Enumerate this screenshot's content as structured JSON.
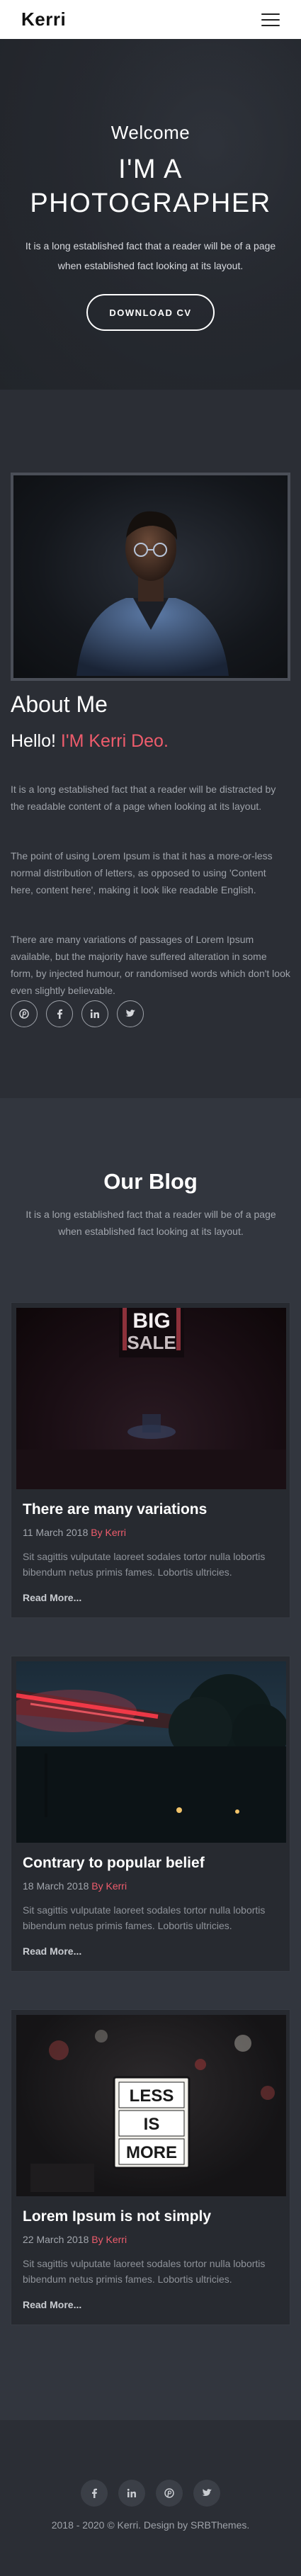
{
  "navbar": {
    "brand": "Kerri",
    "menu_icon": "hamburger-menu-icon"
  },
  "hero": {
    "welcome": "Welcome",
    "title_line1": "I'M A",
    "title_line2": "PHOTOGRAPHER",
    "text": "It is a long established fact that a reader will be of a page when established fact looking at its layout.",
    "button": "DOWNLOAD CV"
  },
  "about": {
    "title": "About Me",
    "hello": "Hello!",
    "name": "I'M Kerri Deo.",
    "paragraphs": [
      "It is a long established fact that a reader will be distracted by the readable content of a page when looking at its layout.",
      "The point of using Lorem Ipsum is that it has a more-or-less normal distribution of letters, as opposed to using 'Content here, content here', making it look like readable English.",
      "There are many variations of passages of Lorem Ipsum available, but the majority have suffered alteration in some form, by injected humour, or randomised words which don't look even slightly believable."
    ],
    "social_icons": [
      "pinterest-icon",
      "facebook-icon",
      "linkedin-icon",
      "twitter-icon"
    ]
  },
  "blog": {
    "title_light": "Our",
    "title_bold": "Blog",
    "subtitle": "It is a long established fact that a reader will be of a page when established fact looking at its layout.",
    "posts": [
      {
        "title": "There are many variations",
        "date": "11 March 2018",
        "by": "By Kerri",
        "text": "Sit sagittis vulputate laoreet sodales tortor nulla lobortis bibendum netus primis fames. Lobortis ultricies.",
        "read_more": "Read More..."
      },
      {
        "title": "Contrary to popular belief",
        "date": "18 March 2018",
        "by": "By Kerri",
        "text": "Sit sagittis vulputate laoreet sodales tortor nulla lobortis bibendum netus primis fames. Lobortis ultricies.",
        "read_more": "Read More..."
      },
      {
        "title": "Lorem Ipsum is not simply",
        "date": "22 March 2018",
        "by": "By Kerri",
        "text": "Sit sagittis vulputate laoreet sodales tortor nulla lobortis bibendum netus primis fames. Lobortis ultricies.",
        "read_more": "Read More..."
      }
    ],
    "img3_sign": [
      "LESS",
      "IS",
      "MORE"
    ],
    "img1_sign": "BIG SALE"
  },
  "footer": {
    "social_icons": [
      "facebook-icon",
      "linkedin-icon",
      "pinterest-icon",
      "twitter-icon"
    ],
    "copyright": "2018 - 2020 © Kerri. Design by SRBThemes."
  },
  "colors": {
    "accent": "#ee5c6c",
    "background": "#2b2e35",
    "navbar": "#ffffff"
  }
}
